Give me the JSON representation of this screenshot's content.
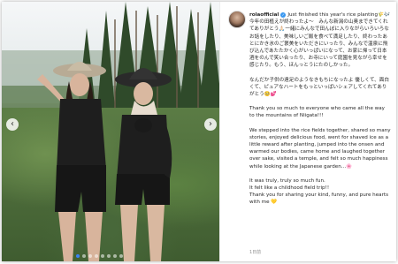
{
  "post": {
    "username": "rolaofficial",
    "posted_time": "1日前",
    "caption_first_line": "Just finished this year's rice planting🌾🎶",
    "caption_ja_1": "今年の田植えが終わったよ〜　みんな新潟の山奥まできてくれてありがとう🙏🏻一緒にみんなで田んぼに入りながらいろいろなお話をしたり、美味しいご飯を食べて満足したり、終わったあとにかき氷のご褒美をいただきにいったり、みんなで温泉に飛び込んであたたかく心がいっぱいになって、お家に帰って日本酒をのんで笑い合ったり、お寺にいって庭園を見ながら幸せを感じたり。もう、ほんっとうにたのしかった。",
    "caption_ja_2": "なんだか子供の遠足のようなきもちになったよ 優しくて、面白くて、ピュアなハートをもっといっぱいシェアしてくれてありがとう🥺💕",
    "caption_en_1": "Thank you so much to everyone who came all the way to the mountains of Niigata!!!",
    "caption_en_2": "We stepped into the rice fields together, shared so many stories, enjoyed delicious food, went for shaved ice as a little reward after planting, jumped into the onsen and warmed our bodies, came home and laughed together over sake, visited a temple, and felt so much happiness while looking at the Japanese garden...🌸",
    "caption_en_3": "It was truly, truly so much fun.",
    "caption_en_4": "It felt like a childhood field trip!!",
    "caption_en_5": "Thank you for sharing your kind, funny, and pure hearts with me 💛"
  },
  "carousel": {
    "prev_icon": "chevron-left-icon",
    "next_icon": "chevron-right-icon",
    "slide_count": 8,
    "active_slide": 1
  },
  "colors": {
    "verified": "#3897f0",
    "active_dot": "#3b82f6",
    "caption_text": "#262626",
    "muted_text": "#8e8e8e"
  }
}
